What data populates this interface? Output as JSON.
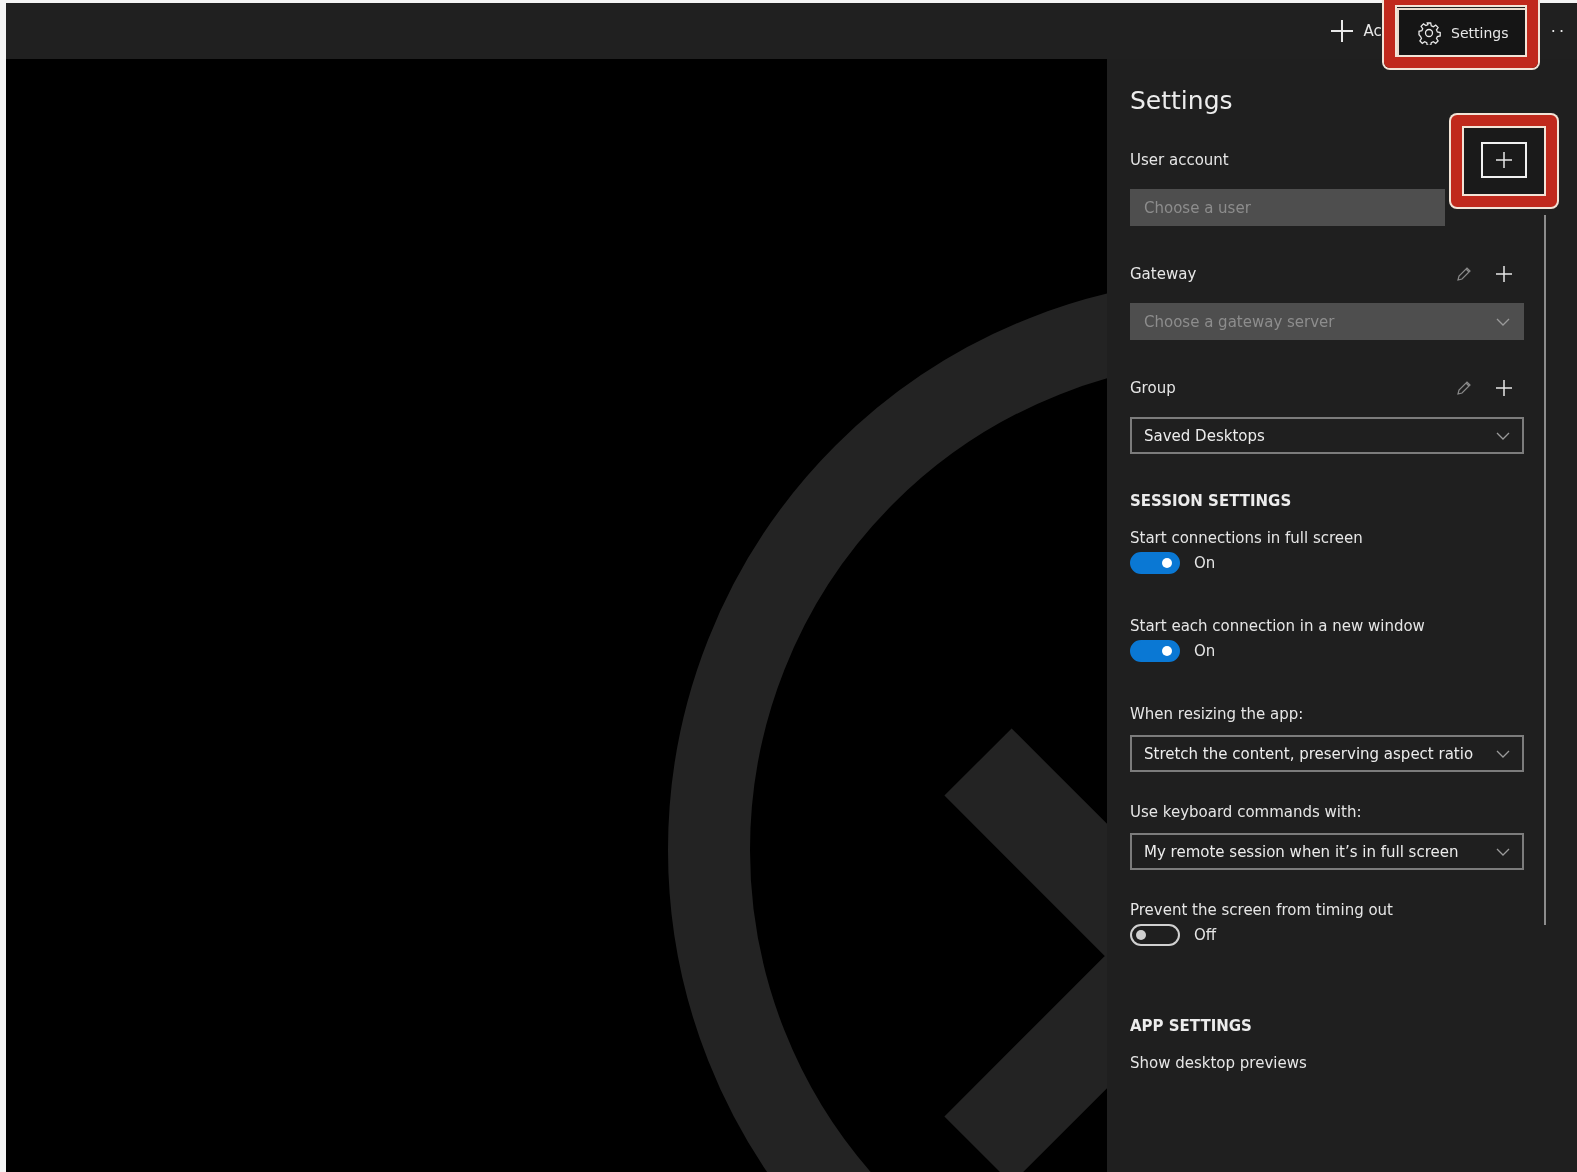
{
  "toolbar": {
    "add_label": "Ac",
    "settings_label": "Settings",
    "settings_highlighted": true,
    "more": "··"
  },
  "settings": {
    "title": "Settings",
    "fields": [
      {
        "label": "User account",
        "placeholder": "Choose a user",
        "disabled": true,
        "edit_icon": false,
        "chevron": false,
        "add_highlighted": true
      },
      {
        "label": "Gateway",
        "placeholder": "Choose a gateway server",
        "disabled": true,
        "edit_icon": true,
        "chevron": true,
        "add_highlighted": false
      },
      {
        "label": "Group",
        "value": "Saved Desktops",
        "disabled": false,
        "edit_icon": true,
        "chevron": true,
        "add_highlighted": false
      }
    ],
    "session_heading": "SESSION SETTINGS",
    "session_items": [
      {
        "kind": "toggle",
        "label": "Start connections in full screen",
        "on": true,
        "state_text": "On"
      },
      {
        "kind": "toggle",
        "label": "Start each connection in a new window",
        "on": true,
        "state_text": "On"
      },
      {
        "kind": "select",
        "label": "When resizing the app:",
        "value": "Stretch the content, preserving aspect ratio"
      },
      {
        "kind": "select",
        "label": "Use keyboard commands with:",
        "value": "My remote session when it’s in full screen"
      },
      {
        "kind": "toggle",
        "label": "Prevent the screen from timing out",
        "on": false,
        "state_text": "Off"
      }
    ],
    "app_heading": "APP SETTINGS",
    "app_items": [
      {
        "label": "Show desktop previews"
      }
    ]
  }
}
